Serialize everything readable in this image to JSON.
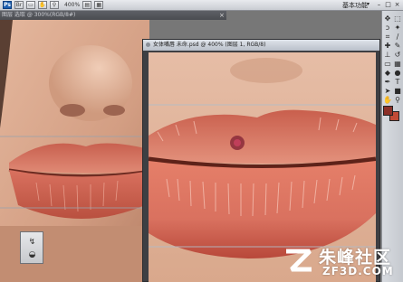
{
  "app": {
    "zoom": "400%",
    "workspace_label": "基本功能",
    "workspace_arrow": "▾",
    "window_buttons": [
      "–",
      "□",
      "×"
    ]
  },
  "background_document": {
    "title": "图层 选取 @ 300%(RGB/8#)",
    "close_glyph": "×"
  },
  "front_document": {
    "title": "女体嘴唇 未命.psd @ 400% (图层 1, RGB/8)"
  },
  "toolbar": {
    "icons": [
      "move-icon",
      "marquee-icon",
      "lasso-icon",
      "magic-wand-icon",
      "crop-icon",
      "eyedropper-icon",
      "healing-brush-icon",
      "brush-icon",
      "clone-stamp-icon",
      "history-brush-icon",
      "eraser-icon",
      "gradient-icon",
      "blur-icon",
      "dodge-icon",
      "pen-icon",
      "type-icon",
      "path-select-icon",
      "shape-icon",
      "hand-icon",
      "zoom-icon"
    ],
    "foreground_color": "#8b3028",
    "background_color": "#c24a35"
  },
  "watermark": {
    "cn": "朱峰社区",
    "en": "ZF3D.COM"
  },
  "colors": {
    "lip": "#d9715f",
    "lip_dark": "#b8483a",
    "skin": "#d9a88c",
    "canvas_bg": "#6b6b6b"
  }
}
